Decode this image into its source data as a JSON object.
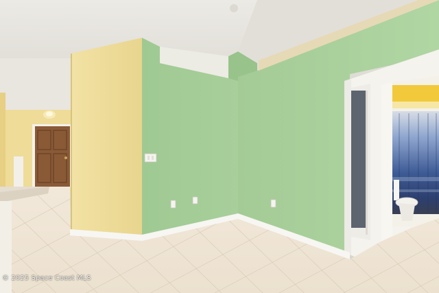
{
  "photo": {
    "watermark": "© 2025 Space Coast MLS"
  },
  "colors": {
    "ceiling": "#e8e6e1",
    "wall_green": "#a9cf9c",
    "wall_green_shadow": "#93bb88",
    "wall_yellow": "#efdf9c",
    "floor_tile": "#f0e6d6",
    "grout": "#d8cbb6",
    "door_wood": "#8a5a36",
    "trim": "#f7f6f2",
    "bath_yellow": "#f1c93a",
    "curtain_blue": "#3e5b96"
  },
  "icons": [
    "ceiling-light-icon",
    "light-switch-icon",
    "outlet-icon",
    "toilet-icon"
  ]
}
